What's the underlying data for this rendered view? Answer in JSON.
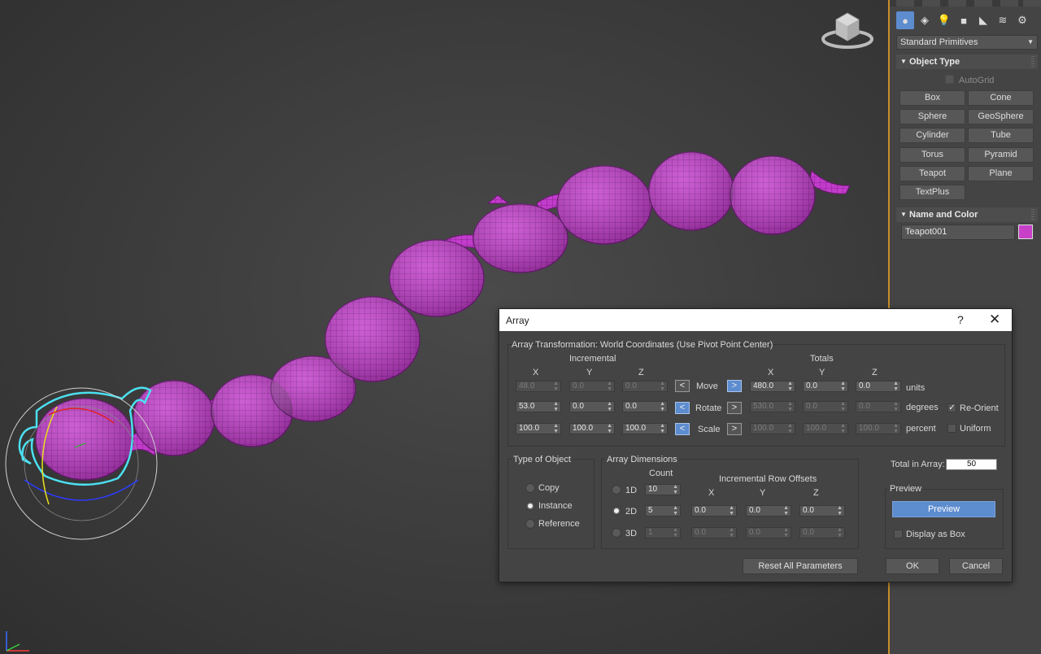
{
  "command_panel": {
    "dropdown": "Standard Primitives",
    "object_type": {
      "title": "Object Type",
      "autogrid": "AutoGrid",
      "buttons": [
        "Box",
        "Cone",
        "Sphere",
        "GeoSphere",
        "Cylinder",
        "Tube",
        "Torus",
        "Pyramid",
        "Teapot",
        "Plane",
        "TextPlus"
      ]
    },
    "name_and_color": {
      "title": "Name and Color",
      "name": "Teapot001",
      "color": "#c840c8"
    }
  },
  "dialog": {
    "title": "Array",
    "help": "?",
    "close": "✕",
    "array_transformation": {
      "title": "Array Transformation: World Coordinates (Use Pivot Point Center)",
      "incremental_label": "Incremental",
      "totals_label": "Totals",
      "axes": [
        "X",
        "Y",
        "Z"
      ],
      "rows": [
        {
          "name": "Move",
          "inc": [
            "48.0",
            "0.0",
            "0.0"
          ],
          "tot": [
            "480.0",
            "0.0",
            "0.0"
          ],
          "unit": "units",
          "left_active": false,
          "right_active": true
        },
        {
          "name": "Rotate",
          "inc": [
            "53.0",
            "0.0",
            "0.0"
          ],
          "tot": [
            "530.0",
            "0.0",
            "0.0"
          ],
          "unit": "degrees",
          "left_active": true,
          "right_active": false
        },
        {
          "name": "Scale",
          "inc": [
            "100.0",
            "100.0",
            "100.0"
          ],
          "tot": [
            "100.0",
            "100.0",
            "100.0"
          ],
          "unit": "percent",
          "left_active": true,
          "right_active": false
        }
      ],
      "re_orient": "Re-Orient",
      "uniform": "Uniform"
    },
    "type_of_object": {
      "title": "Type of Object",
      "options": [
        "Copy",
        "Instance",
        "Reference"
      ],
      "selected": "Instance"
    },
    "array_dimensions": {
      "title": "Array Dimensions",
      "count_label": "Count",
      "offsets_label": "Incremental Row Offsets",
      "axes": [
        "X",
        "Y",
        "Z"
      ],
      "rows": [
        {
          "dim": "1D",
          "count": "10",
          "offsets": []
        },
        {
          "dim": "2D",
          "count": "5",
          "offsets": [
            "0.0",
            "0.0",
            "0.0"
          ]
        },
        {
          "dim": "3D",
          "count": "1",
          "offsets": [
            "0.0",
            "0.0",
            "0.0"
          ]
        }
      ],
      "selected": "2D"
    },
    "total_in_array": {
      "label": "Total in Array:",
      "value": "50"
    },
    "preview": {
      "title": "Preview",
      "button": "Preview",
      "display_as_box": "Display as Box"
    },
    "reset_button": "Reset All Parameters",
    "ok_button": "OK",
    "cancel_button": "Cancel"
  }
}
